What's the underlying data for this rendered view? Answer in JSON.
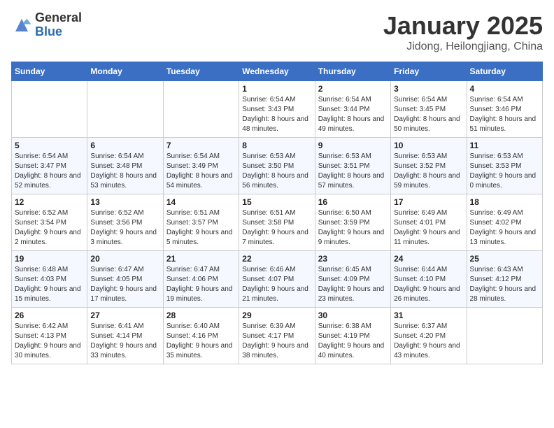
{
  "logo": {
    "general": "General",
    "blue": "Blue"
  },
  "header": {
    "month": "January 2025",
    "location": "Jidong, Heilongjiang, China"
  },
  "weekdays": [
    "Sunday",
    "Monday",
    "Tuesday",
    "Wednesday",
    "Thursday",
    "Friday",
    "Saturday"
  ],
  "weeks": [
    [
      {
        "day": "",
        "info": ""
      },
      {
        "day": "",
        "info": ""
      },
      {
        "day": "",
        "info": ""
      },
      {
        "day": "1",
        "info": "Sunrise: 6:54 AM\nSunset: 3:43 PM\nDaylight: 8 hours\nand 48 minutes."
      },
      {
        "day": "2",
        "info": "Sunrise: 6:54 AM\nSunset: 3:44 PM\nDaylight: 8 hours\nand 49 minutes."
      },
      {
        "day": "3",
        "info": "Sunrise: 6:54 AM\nSunset: 3:45 PM\nDaylight: 8 hours\nand 50 minutes."
      },
      {
        "day": "4",
        "info": "Sunrise: 6:54 AM\nSunset: 3:46 PM\nDaylight: 8 hours\nand 51 minutes."
      }
    ],
    [
      {
        "day": "5",
        "info": "Sunrise: 6:54 AM\nSunset: 3:47 PM\nDaylight: 8 hours\nand 52 minutes."
      },
      {
        "day": "6",
        "info": "Sunrise: 6:54 AM\nSunset: 3:48 PM\nDaylight: 8 hours\nand 53 minutes."
      },
      {
        "day": "7",
        "info": "Sunrise: 6:54 AM\nSunset: 3:49 PM\nDaylight: 8 hours\nand 54 minutes."
      },
      {
        "day": "8",
        "info": "Sunrise: 6:53 AM\nSunset: 3:50 PM\nDaylight: 8 hours\nand 56 minutes."
      },
      {
        "day": "9",
        "info": "Sunrise: 6:53 AM\nSunset: 3:51 PM\nDaylight: 8 hours\nand 57 minutes."
      },
      {
        "day": "10",
        "info": "Sunrise: 6:53 AM\nSunset: 3:52 PM\nDaylight: 8 hours\nand 59 minutes."
      },
      {
        "day": "11",
        "info": "Sunrise: 6:53 AM\nSunset: 3:53 PM\nDaylight: 9 hours\nand 0 minutes."
      }
    ],
    [
      {
        "day": "12",
        "info": "Sunrise: 6:52 AM\nSunset: 3:54 PM\nDaylight: 9 hours\nand 2 minutes."
      },
      {
        "day": "13",
        "info": "Sunrise: 6:52 AM\nSunset: 3:56 PM\nDaylight: 9 hours\nand 3 minutes."
      },
      {
        "day": "14",
        "info": "Sunrise: 6:51 AM\nSunset: 3:57 PM\nDaylight: 9 hours\nand 5 minutes."
      },
      {
        "day": "15",
        "info": "Sunrise: 6:51 AM\nSunset: 3:58 PM\nDaylight: 9 hours\nand 7 minutes."
      },
      {
        "day": "16",
        "info": "Sunrise: 6:50 AM\nSunset: 3:59 PM\nDaylight: 9 hours\nand 9 minutes."
      },
      {
        "day": "17",
        "info": "Sunrise: 6:49 AM\nSunset: 4:01 PM\nDaylight: 9 hours\nand 11 minutes."
      },
      {
        "day": "18",
        "info": "Sunrise: 6:49 AM\nSunset: 4:02 PM\nDaylight: 9 hours\nand 13 minutes."
      }
    ],
    [
      {
        "day": "19",
        "info": "Sunrise: 6:48 AM\nSunset: 4:03 PM\nDaylight: 9 hours\nand 15 minutes."
      },
      {
        "day": "20",
        "info": "Sunrise: 6:47 AM\nSunset: 4:05 PM\nDaylight: 9 hours\nand 17 minutes."
      },
      {
        "day": "21",
        "info": "Sunrise: 6:47 AM\nSunset: 4:06 PM\nDaylight: 9 hours\nand 19 minutes."
      },
      {
        "day": "22",
        "info": "Sunrise: 6:46 AM\nSunset: 4:07 PM\nDaylight: 9 hours\nand 21 minutes."
      },
      {
        "day": "23",
        "info": "Sunrise: 6:45 AM\nSunset: 4:09 PM\nDaylight: 9 hours\nand 23 minutes."
      },
      {
        "day": "24",
        "info": "Sunrise: 6:44 AM\nSunset: 4:10 PM\nDaylight: 9 hours\nand 26 minutes."
      },
      {
        "day": "25",
        "info": "Sunrise: 6:43 AM\nSunset: 4:12 PM\nDaylight: 9 hours\nand 28 minutes."
      }
    ],
    [
      {
        "day": "26",
        "info": "Sunrise: 6:42 AM\nSunset: 4:13 PM\nDaylight: 9 hours\nand 30 minutes."
      },
      {
        "day": "27",
        "info": "Sunrise: 6:41 AM\nSunset: 4:14 PM\nDaylight: 9 hours\nand 33 minutes."
      },
      {
        "day": "28",
        "info": "Sunrise: 6:40 AM\nSunset: 4:16 PM\nDaylight: 9 hours\nand 35 minutes."
      },
      {
        "day": "29",
        "info": "Sunrise: 6:39 AM\nSunset: 4:17 PM\nDaylight: 9 hours\nand 38 minutes."
      },
      {
        "day": "30",
        "info": "Sunrise: 6:38 AM\nSunset: 4:19 PM\nDaylight: 9 hours\nand 40 minutes."
      },
      {
        "day": "31",
        "info": "Sunrise: 6:37 AM\nSunset: 4:20 PM\nDaylight: 9 hours\nand 43 minutes."
      },
      {
        "day": "",
        "info": ""
      }
    ]
  ]
}
